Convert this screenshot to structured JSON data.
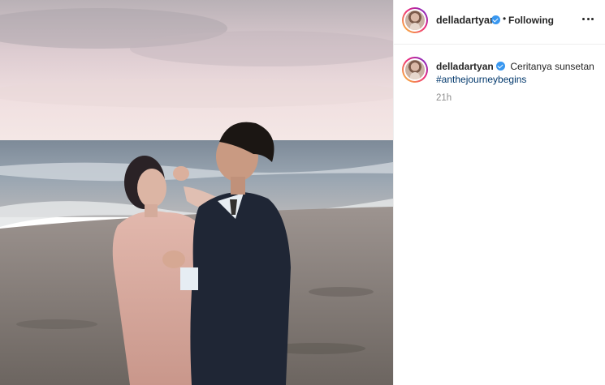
{
  "post": {
    "header": {
      "username": "delladartyan",
      "separator": "•",
      "follow_status": "Following",
      "avatar_icon": "profile-avatar",
      "verified_icon": "verified-badge-icon",
      "more_icon": "more-options-icon"
    },
    "caption": {
      "username": "delladartyan",
      "text": "Ceritanya sunsetan",
      "hashtag": "#anthejourneybegins",
      "time": "21h"
    },
    "photo": {
      "subject": "couple on beach at sunset"
    },
    "colors": {
      "verified": "#3897f0",
      "hashtag": "#00376b",
      "meta": "#8e8e8e",
      "text": "#262626"
    }
  }
}
